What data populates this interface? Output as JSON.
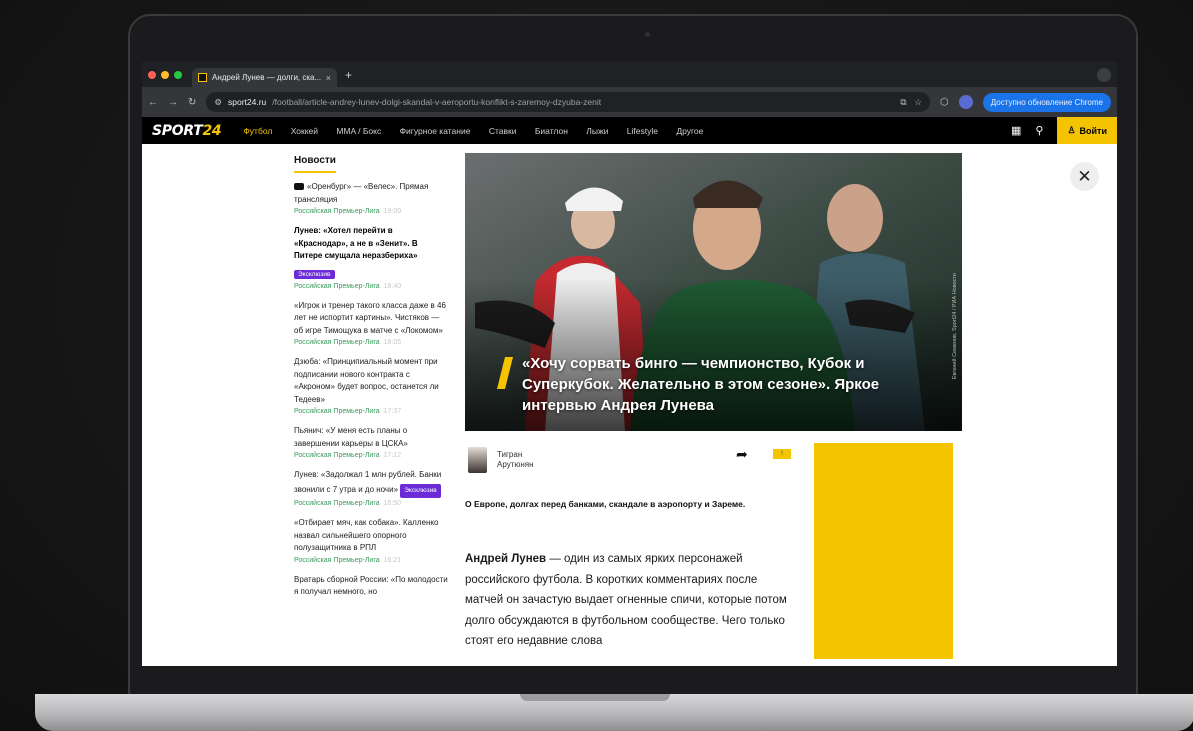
{
  "browser": {
    "tab_title": "Андрей Лунев — долги, ска...",
    "tab_close": "×",
    "new_tab": "+",
    "url_host": "sport24.ru",
    "url_path": "/football/article-andrey-lunev-dolgi-skandal-v-aeroportu-konflikt-s-zaremoy-dzyuba-zenit",
    "update_label": "Доступно обновление Chrome"
  },
  "site": {
    "logo_main": "SPORT",
    "logo_num": "24",
    "nav": [
      "Футбол",
      "Хоккей",
      "MMA / Бокс",
      "Фигурное катание",
      "Ставки",
      "Биатлон",
      "Лыжи",
      "Lifestyle",
      "Другое"
    ],
    "login_label": "Войти"
  },
  "news": {
    "heading": "Новости",
    "items": [
      {
        "title": "«Оренбург» — «Велес». Прямая трансляция",
        "league": "Российская Премьер-Лига",
        "time": "19:00"
      },
      {
        "title": "Лунев: «Хотел перейти в «Краснодар», а не в «Зенит». В Питере смущала неразбериха»",
        "badge": "Эксклюзив",
        "league": "Российская Премьер-Лига",
        "time": "18:40"
      },
      {
        "title": "«Игрок и тренер такого класса даже в 46 лет не испортит картины». Чистяков — об игре Тимощука в матче с «Локомом»",
        "league": "Российская Премьер-Лига",
        "time": "18:05"
      },
      {
        "title": "Дзюба: «Принципиальный момент при подписании нового контракта с «Акроном» будет вопрос, останется ли Тедеев»",
        "league": "Российская Премьер-Лига",
        "time": "17:37"
      },
      {
        "title": "Пьянич: «У меня есть планы о завершении карьеры в ЦСКА»",
        "league": "Российская Премьер-Лига",
        "time": "17:12"
      },
      {
        "title": "Лунев: «Задолжал 1 млн рублей. Банки звонили с 7 утра и до ночи»",
        "badge": "Эксклюзив",
        "league": "Российская Премьер-Лига",
        "time": "16:50"
      },
      {
        "title": "«Отбирает мяч, как собака». Калленко назвал сильнейшего опорного полузащитника в РПЛ",
        "league": "Российская Премьер-Лига",
        "time": "16:21"
      },
      {
        "title": "Вратарь сборной России: «По молодости я получал немного, но",
        "league": "",
        "time": ""
      }
    ]
  },
  "article": {
    "hero_title": "«Хочу сорвать бинго — чемпионство, Кубок и Суперкубок. Желательно в этом сезоне». Яркое интервью Андрея Лунева",
    "photo_credit": "Евгений Семенов, Sport24 / РИА Новости",
    "author_first": "Тигран",
    "author_last": "Арутюнян",
    "lead": "О Европе, долгах перед банками, скандале в аэропорту и Зареме.",
    "body_name": "Андрей Лунев",
    "body_text": " — один из самых ярких персонажей российского футбола. В коротких комментариях после матчей он зачастую выдает огненные спичи, которые потом долго обсуждаются в футбольном сообществе. Чего только стоят его недавние слова"
  },
  "colors": {
    "accent": "#f5c400",
    "badge": "#6b2bd6",
    "league": "#3a9a5d"
  }
}
